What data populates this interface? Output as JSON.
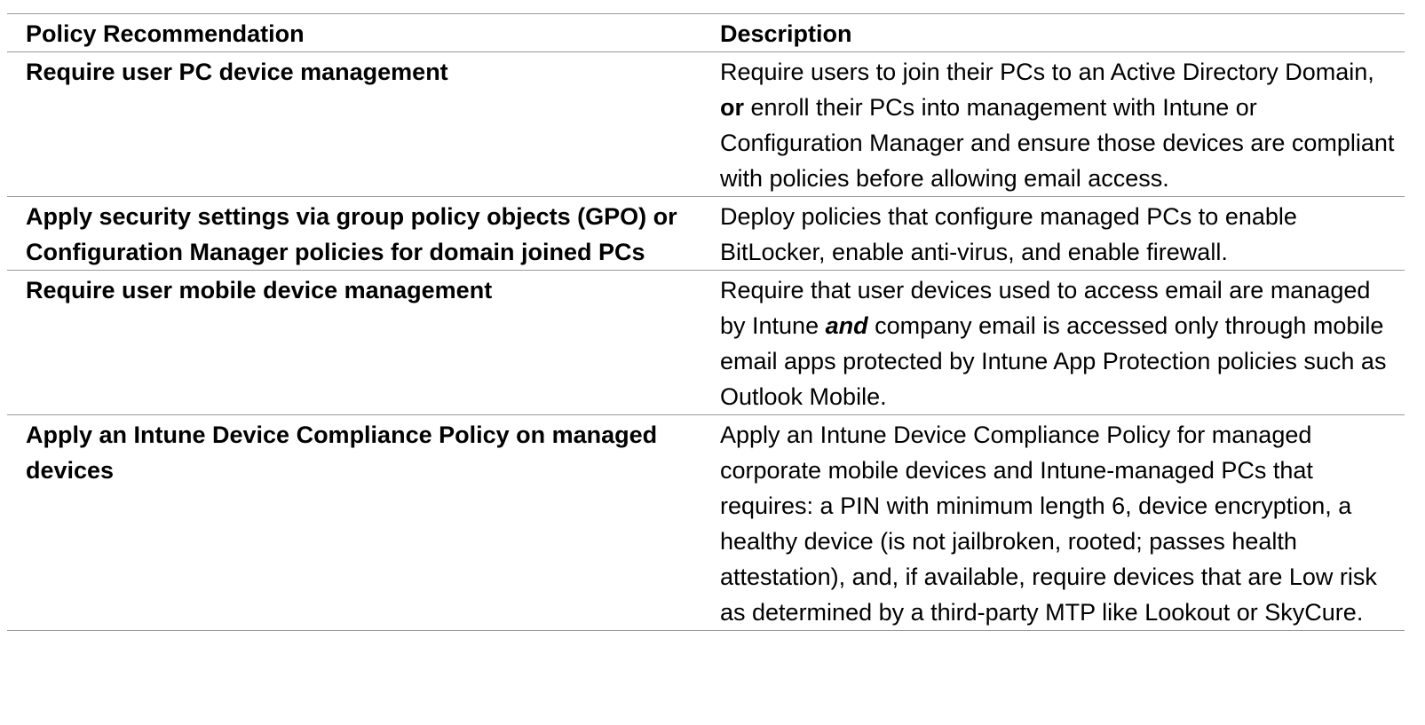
{
  "table": {
    "headers": {
      "policy": "Policy Recommendation",
      "description": "Description"
    },
    "rows": [
      {
        "policy": "Require user PC device management",
        "description": {
          "before": "Require users to join their PCs to an Active Directory Domain, ",
          "emphasis": "or",
          "after": " enroll their PCs into management with Intune or Configuration Manager and ensure those devices are compliant with policies before allowing email access."
        }
      },
      {
        "policy": "Apply security settings via group policy objects (GPO) or Configuration Manager policies for domain joined PCs",
        "description": {
          "text": "Deploy policies that configure managed PCs to enable BitLocker, enable anti-virus, and enable firewall."
        }
      },
      {
        "policy": "Require user mobile device management",
        "description": {
          "before": "Require that user devices used to access email are managed by Intune ",
          "emphasis": "and",
          "after": " company email is accessed only through mobile email apps protected by Intune App Protection policies such as Outlook Mobile."
        }
      },
      {
        "policy": "Apply an Intune Device Compliance Policy on managed devices",
        "description": {
          "text": "Apply an Intune Device Compliance Policy for managed corporate mobile devices and Intune-managed PCs that requires: a PIN with minimum length 6, device encryption, a healthy device (is not jailbroken, rooted; passes health attestation), and, if available, require devices that are Low risk as determined by a third-party MTP like Lookout or SkyCure."
        }
      }
    ]
  }
}
